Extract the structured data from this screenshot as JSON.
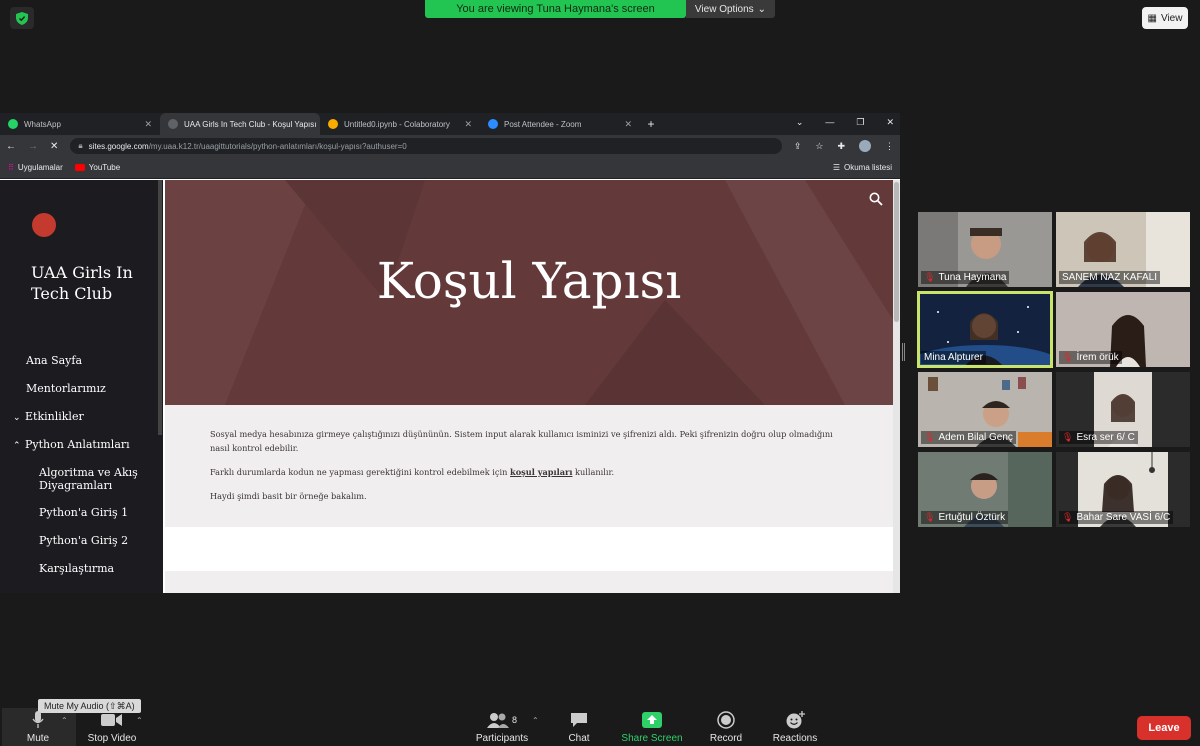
{
  "zoom": {
    "banner": "You are viewing Tuna Haymana's screen",
    "view_options": "View Options",
    "view_button": "View"
  },
  "browser": {
    "tabs": [
      {
        "label": "WhatsApp",
        "icon": "whatsapp-icon",
        "color": "#25d366"
      },
      {
        "label": "UAA Girls In Tech Club - Koşul Yapısı",
        "icon": "sites-icon",
        "color": "#5f6368"
      },
      {
        "label": "Untitled0.ipynb - Colaboratory",
        "icon": "colab-icon",
        "color": "#f9ab00"
      },
      {
        "label": "Post Attendee - Zoom",
        "icon": "zoom-icon",
        "color": "#2d8cff"
      }
    ],
    "url_host": "sites.google.com",
    "url_path": "/my.uaa.k12.tr/uaagittutorials/python-anlatımları/koşul-yapısı?authuser=0",
    "bookmarks": [
      "Uygulamalar",
      "YouTube"
    ],
    "reading_list": "Okuma listesi"
  },
  "site": {
    "name": "UAA Girls In Tech Club",
    "nav": [
      {
        "label": "Ana Sayfa",
        "chevron": ""
      },
      {
        "label": "Mentorlarımız",
        "chevron": ""
      },
      {
        "label": "Etkinlikler",
        "chevron": "v"
      },
      {
        "label": "Python Anlatımları",
        "chevron": "^"
      },
      {
        "label": "Algoritma ve Akış Diyagramları",
        "chevron": ""
      },
      {
        "label": "Python'a Giriş 1",
        "chevron": ""
      },
      {
        "label": "Python'a Giriş 2",
        "chevron": ""
      },
      {
        "label": "Karşılaştırma",
        "chevron": ""
      }
    ],
    "hero_title": "Koşul Yapısı",
    "paragraph1": "Sosyal medya hesabınıza girmeye çalıştığınızı düşününün. Sistem input alarak kullanıcı isminizi ve şifrenizi aldı. Peki şifrenizin doğru olup olmadığını nasıl kontrol edebilir.",
    "paragraph2_before": "Farklı durumlarda kodun ne yapması gerektiğini kontrol edebilmek için",
    "paragraph2_link": "koşul yapıları",
    "paragraph2_after": "kullanılır.",
    "paragraph3": "Haydi şimdi basit bir örneğe bakalım."
  },
  "participants": [
    {
      "name": "Tuna Haymana",
      "muted": true,
      "bg": "#8d8c8a"
    },
    {
      "name": "SANEM NAZ KAFALI",
      "muted": false,
      "bg": "#c9c2b4"
    },
    {
      "name": "Mina Alpturer",
      "muted": false,
      "bg": "#1c2d4e",
      "speaking": true
    },
    {
      "name": "İrem örük",
      "muted": true,
      "bg": "#bdb3ad"
    },
    {
      "name": "Adem Bilal Genç",
      "muted": true,
      "bg": "#a9a7a4"
    },
    {
      "name": "Esra ser 6/ C",
      "muted": true,
      "bg": "#cfc9c1"
    },
    {
      "name": "Ertuğtul Öztürk",
      "muted": true,
      "bg": "#6f7b73"
    },
    {
      "name": "Bahar Sare VASİ 6/C",
      "muted": true,
      "bg": "#e0dcd6"
    }
  ],
  "toolbar": {
    "tooltip": "Mute My Audio (⇧⌘A)",
    "mute": "Mute",
    "stop_video": "Stop Video",
    "participants": "Participants",
    "participant_count": "8",
    "chat": "Chat",
    "share_screen": "Share Screen",
    "record": "Record",
    "reactions": "Reactions",
    "leave": "Leave"
  }
}
